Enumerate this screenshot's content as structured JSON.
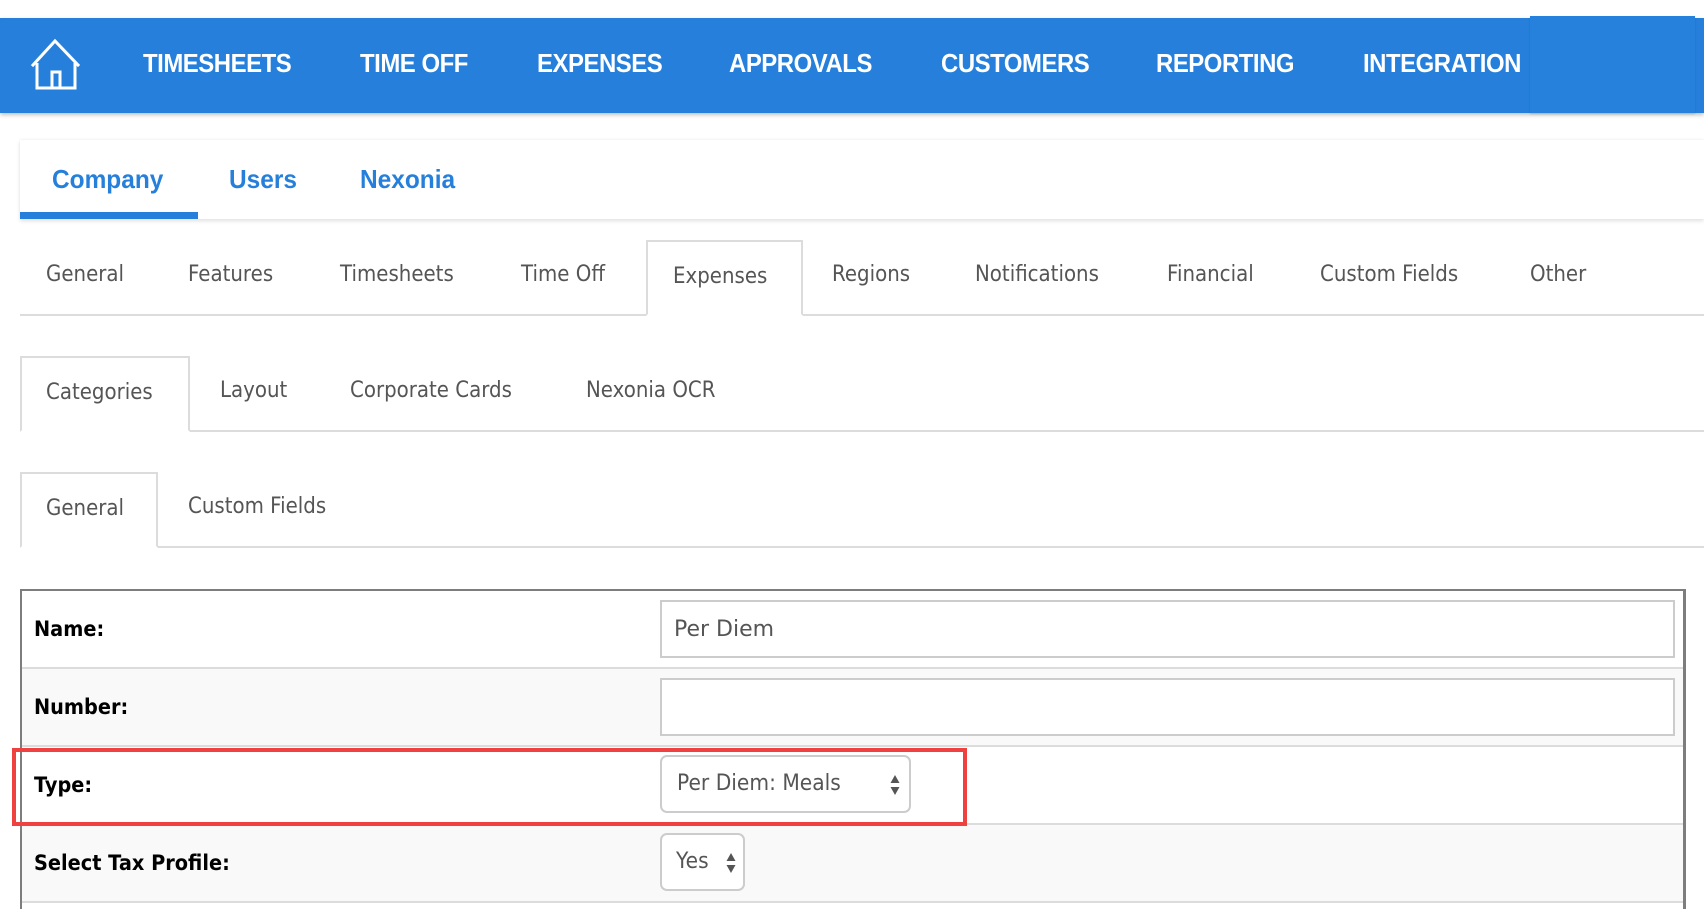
{
  "topnav": {
    "home_icon": "home-icon",
    "items": [
      {
        "label": "TIMESHEETS"
      },
      {
        "label": "TIME OFF"
      },
      {
        "label": "EXPENSES"
      },
      {
        "label": "APPROVALS"
      },
      {
        "label": "CUSTOMERS"
      },
      {
        "label": "REPORTING"
      },
      {
        "label": "INTEGRATION"
      }
    ]
  },
  "section_tabs": {
    "active": "Company",
    "items": [
      {
        "label": "Company"
      },
      {
        "label": "Users"
      },
      {
        "label": "Nexonia"
      }
    ]
  },
  "settings_tabs": {
    "active": "Expenses",
    "items": [
      {
        "label": "General"
      },
      {
        "label": "Features"
      },
      {
        "label": "Timesheets"
      },
      {
        "label": "Time Off"
      },
      {
        "label": "Expenses"
      },
      {
        "label": "Regions"
      },
      {
        "label": "Notifications"
      },
      {
        "label": "Financial"
      },
      {
        "label": "Custom Fields"
      },
      {
        "label": "Other"
      }
    ]
  },
  "expense_tabs": {
    "active": "Categories",
    "items": [
      {
        "label": "Categories"
      },
      {
        "label": "Layout"
      },
      {
        "label": "Corporate Cards"
      },
      {
        "label": "Nexonia OCR"
      }
    ]
  },
  "category_tabs": {
    "active": "General",
    "items": [
      {
        "label": "General"
      },
      {
        "label": "Custom Fields"
      }
    ]
  },
  "form": {
    "name": {
      "label": "Name:",
      "value": "Per Diem"
    },
    "number": {
      "label": "Number:",
      "value": ""
    },
    "type": {
      "label": "Type:",
      "selected": "Per Diem: Meals"
    },
    "tax_profile": {
      "label": "Select Tax Profile:",
      "selected": "Yes"
    }
  },
  "highlight": {
    "target": "type",
    "color": "#f04141"
  },
  "colors": {
    "brand_blue": "#2680db",
    "tab_text": "#555555",
    "border": "#dcdcdc"
  }
}
